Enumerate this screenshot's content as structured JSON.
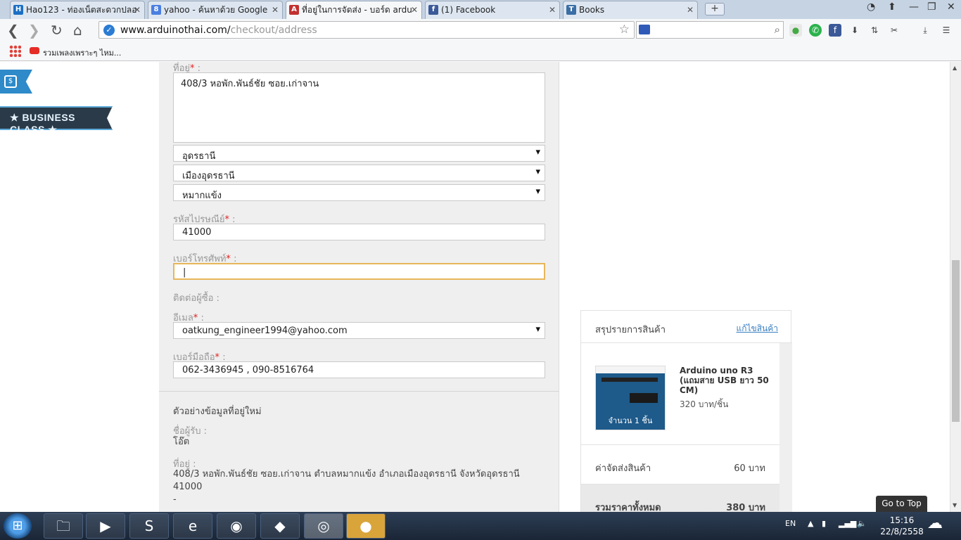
{
  "browser": {
    "tabs": [
      {
        "title": "Hao123 - ท่องเน็ตสะดวกปลอ",
        "favicon": "H",
        "color": "#1a6fc4"
      },
      {
        "title": "yahoo - ค้นหาด้วย Google",
        "favicon": "8",
        "color": "#4a7fe0"
      },
      {
        "title": "ที่อยู่ในการจัดส่ง - บอร์ด ardu",
        "favicon": "A",
        "color": "#c23030"
      },
      {
        "title": "(1) Facebook",
        "favicon": "f",
        "color": "#3b5998"
      },
      {
        "title": "Books",
        "favicon": "T",
        "color": "#3a6ea5"
      }
    ],
    "new_tab": "+",
    "url_host": "www.arduinothai.com/",
    "url_path": "checkout/address",
    "bookmark_label": "รวมเพลงเพราะๆ ไหม..."
  },
  "sidebar": {
    "business_class": "★ BUSINESS CLASS ★",
    "currency_icon": "$"
  },
  "form": {
    "address_label": "ที่อยู่",
    "address_value": "408/3 หอพัก.พันธ์ชัย ซอย.เก่าจาน",
    "province": "อุดรธานี",
    "district": "เมืองอุดรธานี",
    "subdistrict": "หมากแข้ง",
    "postcode_label": "รหัสไปรษณีย์",
    "postcode_value": "41000",
    "phone_label": "เบอร์โทรศัพท์",
    "phone_value": "|",
    "contact_label": "ติดต่อผู้ซื้อ :",
    "email_label": "อีเมล",
    "email_value": "oatkung_engineer1994@yahoo.com",
    "mobile_label": "เบอร์มือถือ",
    "mobile_value": "062-3436945 , 090-8516764",
    "required_mark": "*",
    "colon": ":"
  },
  "preview": {
    "title": "ตัวอย่างข้อมูลที่อยู่ใหม่",
    "recipient_label": "ชื่อผู้รับ :",
    "recipient_value": "โอ๊ต",
    "address_label": "ที่อยู่ :",
    "address_line": "408/3 หอพัก.พันธ์ชัย ซอย.เก่าจาน ตำบลหมากแข้ง อำเภอเมืองอุดรธานี จังหวัดอุดรธานี",
    "postcode": "41000",
    "dash": "-"
  },
  "summary": {
    "title": "สรุปรายการสินค้า",
    "edit_link": "แก้ไขสินค้า",
    "product_name": "Arduino uno R3 (แถมสาย USB ยาว 50 CM)",
    "product_price": "320 บาท/ชิ้น",
    "product_qty": "จำนวน 1 ชิ้น",
    "shipping_label": "ค่าจัดส่งสินค้า",
    "shipping_value": "60 บาท",
    "total_label": "รวมราคาทั้งหมด",
    "total_value": "380 บาท"
  },
  "go_to_top": "Go to Top",
  "taskbar": {
    "lang": "EN",
    "time": "15:16",
    "date": "22/8/2558"
  }
}
